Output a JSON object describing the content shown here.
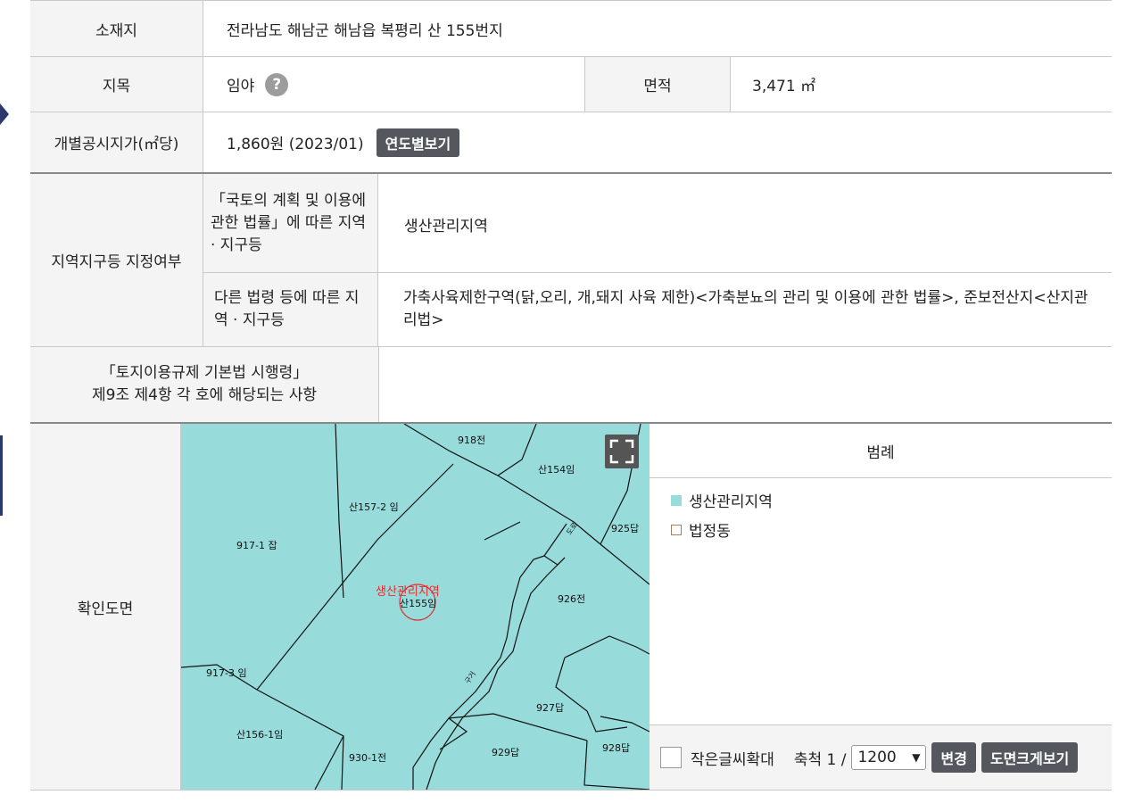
{
  "row1": {
    "label": "소재지",
    "value": "전라남도 해남군 해남읍 복평리 산 155번지"
  },
  "row2": {
    "label": "지목",
    "value": "임야",
    "help": "?",
    "area_label": "면적",
    "area_value": "3,471 ㎡"
  },
  "row3": {
    "label": "개별공시지가(㎡당)",
    "value": "1,860원 (2023/01)",
    "button": "연도별보기"
  },
  "zone": {
    "label": "지역지구등 지정여부",
    "sub1_label": "「국토의 계획 및 이용에 관한 법률」에 따른 지역 · 지구등",
    "sub1_value": "생산관리지역",
    "sub2_label": "다른 법령 등에 따른 지역 · 지구등",
    "sub2_value": "가축사육제한구역(닭,오리, 개,돼지 사육 제한)<가축분뇨의 관리 및 이용에 관한 법률>, 준보전산지<산지관리법>"
  },
  "enforcement": {
    "label": "「토지이용규제 기본법 시행령」\n제9조 제4항 각 호에 해당되는 사항",
    "value": ""
  },
  "map": {
    "label": "확인도면",
    "parcels": [
      "918전",
      "산154임",
      "산157-2 임",
      "925답",
      "917-1 잡",
      "생산관리지역",
      "산155임",
      "926전",
      "917-3 임",
      "927답",
      "산156-1임",
      "928답",
      "930-1전",
      "929답",
      "도로",
      "구거"
    ],
    "legend_title": "범례",
    "legend": [
      {
        "name": "생산관리지역",
        "color": "#97dbdb"
      },
      {
        "name": "법정동",
        "color": "#ffffff"
      }
    ],
    "zoom_label": "작은글씨확대",
    "scale_label": "축척 1 /",
    "scale_value": "1200",
    "change_button": "변경",
    "enlarge_button": "도면크게보기"
  }
}
